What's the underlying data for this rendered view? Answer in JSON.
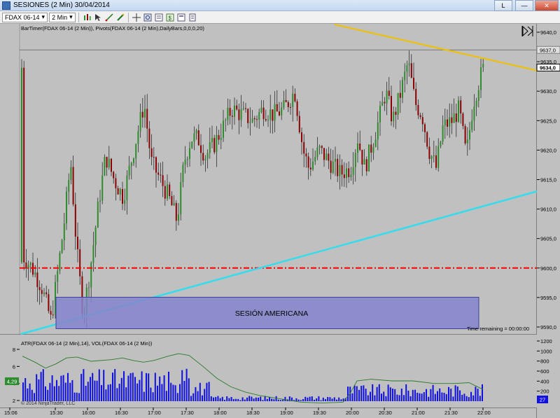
{
  "window": {
    "title": "SESIONES (2 Min)  30/04/2014",
    "restore_label": "L",
    "minimize_label": "—",
    "close_label": "✕"
  },
  "toolbar": {
    "instrument": "FDAX 06-14",
    "interval": "2 Min",
    "icons": [
      "chart-type-icon",
      "pointer-icon",
      "draw-line-icon",
      "pen-icon",
      "crosshair-icon",
      "zoom-icon",
      "properties-icon",
      "strategy-icon",
      "data-box-icon",
      "templates-icon"
    ]
  },
  "chart": {
    "indicator_label": "BarTimer(FDAX 06-14 (2 Min)), Pivots(FDAX 06-14 (2 Min),DailyBars,0,0,0,20)",
    "price_axis": [
      "9640,0",
      "9635,0",
      "9630,0",
      "9625,0",
      "9620,0",
      "9615,0",
      "9610,0",
      "9605,0",
      "9600,0",
      "9595,0",
      "9590,0"
    ],
    "price_axis_values": [
      9640,
      9635,
      9630,
      9625,
      9620,
      9615,
      9610,
      9605,
      9600,
      9595,
      9590
    ],
    "last_price_label": "9634,0",
    "last_price": 9634,
    "high_price_label": "9637,0",
    "high_price": 9637,
    "pivot_level": 9600,
    "time_remaining": "Time remaining = 00:00:00",
    "session_box_label": "SESIÓN AMERICANA",
    "colors": {
      "background": "#c0c0c0",
      "up_candle": "#2e8b2e",
      "down_candle": "#8b0000",
      "wick": "#000000",
      "pivot_line": "#ff0000",
      "support_line": "#33ddee",
      "resistance_line": "#f0c000",
      "session_box": "#8484cc"
    }
  },
  "lower_panel": {
    "label": "ATR(FDAX 06-14 (2 Min),14), VOL(FDAX 06-14 (2 Min))",
    "atr_axis": [
      "8",
      "6",
      "4",
      "2"
    ],
    "atr_axis_values": [
      8,
      6,
      4,
      2
    ],
    "atr_current": "4,29",
    "volume_axis": [
      "1200",
      "1000",
      "800",
      "600",
      "400",
      "200",
      "0"
    ],
    "volume_axis_values": [
      1200,
      1000,
      800,
      600,
      400,
      200,
      0
    ],
    "volume_current": "27",
    "copyright": "© 2014 NinjaTrader, LLC",
    "colors": {
      "atr_line": "#2a7a2a",
      "volume_bars": "#1010e0"
    }
  },
  "time_axis": [
    "15:06",
    "15:30",
    "16:00",
    "16:30",
    "17:00",
    "17:30",
    "18:00",
    "18:30",
    "19:00",
    "19:30",
    "20:00",
    "20:30",
    "21:00",
    "21:30",
    "22:00"
  ]
}
